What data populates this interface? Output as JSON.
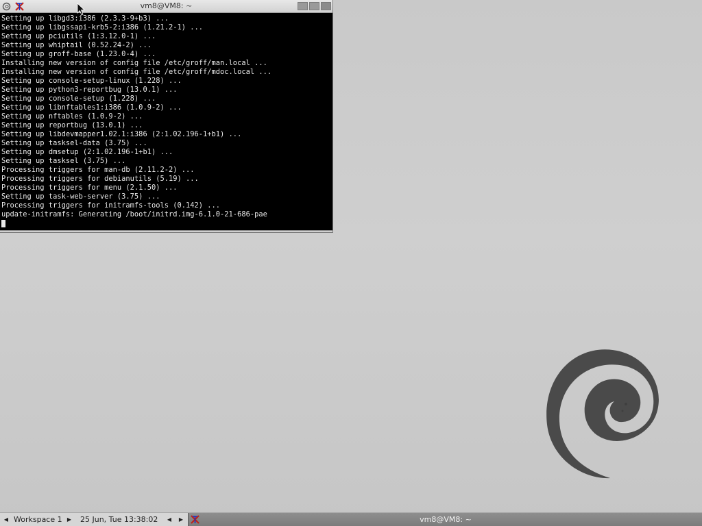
{
  "window": {
    "title": "vm8@VM8: ~"
  },
  "terminal": {
    "lines": [
      "Setting up libgd3:i386 (2.3.3-9+b3) ...",
      "Setting up libgssapi-krb5-2:i386 (1.21.2-1) ...",
      "Setting up pciutils (1:3.12.0-1) ...",
      "Setting up whiptail (0.52.24-2) ...",
      "Setting up groff-base (1.23.0-4) ...",
      "Installing new version of config file /etc/groff/man.local ...",
      "Installing new version of config file /etc/groff/mdoc.local ...",
      "Setting up console-setup-linux (1.228) ...",
      "Setting up python3-reportbug (13.0.1) ...",
      "Setting up console-setup (1.228) ...",
      "Setting up libnftables1:i386 (1.0.9-2) ...",
      "Setting up nftables (1.0.9-2) ...",
      "Setting up reportbug (13.0.1) ...",
      "Setting up libdevmapper1.02.1:i386 (2:1.02.196-1+b1) ...",
      "Setting up tasksel-data (3.75) ...",
      "Setting up dmsetup (2:1.02.196-1+b1) ...",
      "Setting up tasksel (3.75) ...",
      "Processing triggers for man-db (2.11.2-2) ...",
      "Processing triggers for debianutils (5.19) ...",
      "Processing triggers for menu (2.1.50) ...",
      "Setting up task-web-server (3.75) ...",
      "Processing triggers for initramfs-tools (0.142) ...",
      "update-initramfs: Generating /boot/initrd.img-6.1.0-21-686-pae"
    ]
  },
  "taskbar": {
    "workspace_label": "Workspace 1",
    "clock": "25 Jun, Tue 13:38:02",
    "task_label": "vm8@VM8: ~"
  },
  "icons": {
    "window_menu": "debian-swirl-icon",
    "terminal_app": "xterm-icon",
    "arrow_left": "left-arrow-icon",
    "arrow_right": "right-arrow-icon"
  },
  "colors": {
    "terminal_bg": "#000000",
    "terminal_fg": "#eaeaea",
    "desktop_bg": "#cccccc",
    "taskbar_active": "#828282",
    "xterm_icon_red": "#c0221b",
    "xterm_icon_blue": "#1b2fc0"
  }
}
